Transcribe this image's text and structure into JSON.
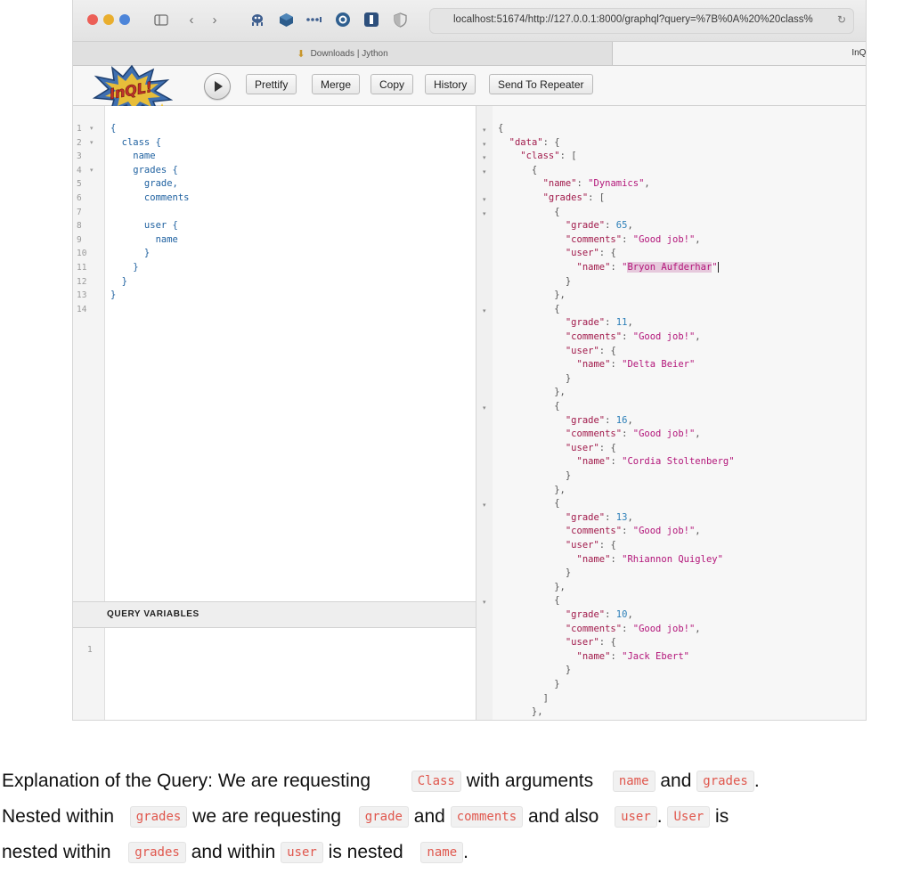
{
  "browser": {
    "url": "localhost:51674/http://127.0.0.1:8000/graphql?query=%7B%0A%20%20class%",
    "tabs": [
      {
        "label": "Downloads | Jython"
      },
      {
        "label": "InQL"
      }
    ],
    "colors": {
      "close": "#ec5f57",
      "minimize": "#e9ae2e",
      "zoom": "#4d85d9"
    }
  },
  "app": {
    "logo_text": "InQL!",
    "toolbar": {
      "run_label": "",
      "prettify": "Prettify",
      "merge": "Merge",
      "copy": "Copy",
      "history": "History",
      "send_to_repeater": "Send To Repeater"
    }
  },
  "query_editor": {
    "lines": [
      {
        "num": "1",
        "text": "{"
      },
      {
        "num": "2",
        "text": "  class {"
      },
      {
        "num": "3",
        "text": "    name"
      },
      {
        "num": "4",
        "text": "    grades {"
      },
      {
        "num": "5",
        "text": "      grade,"
      },
      {
        "num": "6",
        "text": "      comments"
      },
      {
        "num": "7",
        "text": ""
      },
      {
        "num": "8",
        "text": "      user {"
      },
      {
        "num": "9",
        "text": "        name"
      },
      {
        "num": "10",
        "text": "      }"
      },
      {
        "num": "11",
        "text": "    }"
      },
      {
        "num": "12",
        "text": "  }"
      },
      {
        "num": "13",
        "text": "}"
      },
      {
        "num": "14",
        "text": ""
      }
    ],
    "query_variables_title": "QUERY VARIABLES",
    "query_variables_line": "1"
  },
  "response": {
    "class_name": "Dynamics",
    "grades": [
      {
        "grade": "65",
        "comments": "Good job!",
        "user": "Bryon Aufderhar"
      },
      {
        "grade": "11",
        "comments": "Good job!",
        "user": "Delta Beier"
      },
      {
        "grade": "16",
        "comments": "Good job!",
        "user": "Cordia Stoltenberg"
      },
      {
        "grade": "13",
        "comments": "Good job!",
        "user": "Rhiannon Quigley"
      },
      {
        "grade": "10",
        "comments": "Good job!",
        "user": "Jack Ebert"
      }
    ]
  },
  "explanation": {
    "l1_a": "Explanation of the Query: We are requesting",
    "c_class": "Class",
    "l1_b": "with arguments",
    "c_name": "name",
    "l1_c": "and",
    "c_grades": "grades",
    "l1_d": ".",
    "l2_a": "Nested within",
    "c_grades2": "grades",
    "l2_b": "we are requesting",
    "c_grade": "grade",
    "l2_c": "and",
    "c_comments": "comments",
    "l2_d": "and also",
    "c_user": "user",
    "l2_e": ".",
    "c_User": "User",
    "l2_f": "is",
    "l3_a": "nested within",
    "c_grades3": "grades",
    "l3_b": "and within",
    "c_user2": "user",
    "l3_c": "is nested",
    "c_name2": "name",
    "l3_d": "."
  }
}
